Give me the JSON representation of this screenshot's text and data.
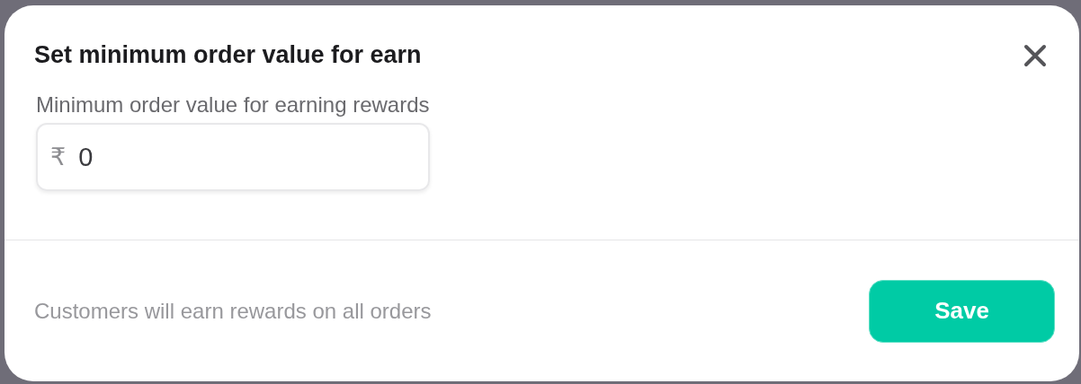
{
  "dialog": {
    "title": "Set minimum order value for earn",
    "field": {
      "label": "Minimum order value for earning rewards",
      "prefix": "₹",
      "value": "0"
    },
    "footer_note": "Customers will earn rewards on all orders",
    "buttons": [
      {
        "label": "Save",
        "kind": "primary"
      }
    ]
  }
}
